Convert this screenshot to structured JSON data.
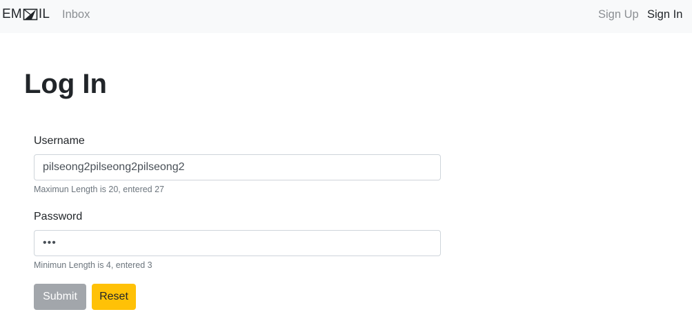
{
  "navbar": {
    "brand_pre": "EM",
    "brand_post": "IL",
    "brand_logo_icon": "envelope-paper-plane-icon",
    "inbox_label": "Inbox",
    "signup_label": "Sign Up",
    "signin_label": "Sign In"
  },
  "page": {
    "title": "Log In"
  },
  "form": {
    "username": {
      "label": "Username",
      "value": "pilseong2pilseong2pilseong2",
      "help": "Maximun Length is 20, entered 27"
    },
    "password": {
      "label": "Password",
      "value": "•••",
      "help": "Minimun Length is 4, entered 3"
    },
    "submit_label": "Submit",
    "reset_label": "Reset"
  },
  "colors": {
    "navbar_bg": "#f8f9fa",
    "submit_bg": "#a2a6ab",
    "reset_bg": "#ffc107",
    "muted_text": "#6c757d"
  }
}
